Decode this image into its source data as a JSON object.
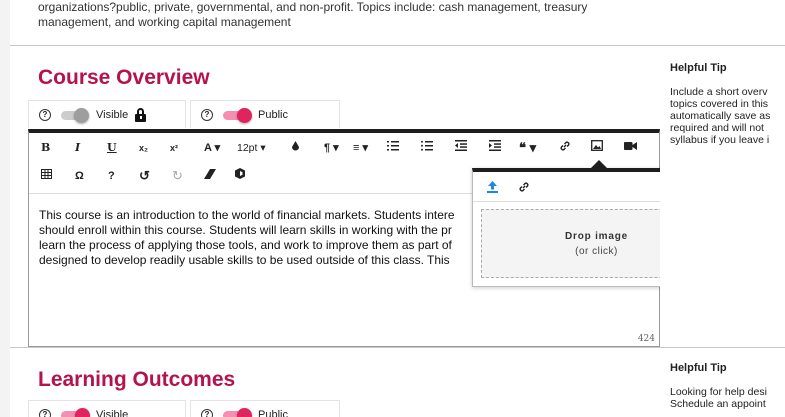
{
  "top_section": {
    "description_line1": "organizations?public, private, governmental, and non-profit. Topics include: cash management, treasury",
    "description_line2": "management, and working capital management"
  },
  "course_overview": {
    "title": "Course Overview",
    "visible_label": "Visible",
    "visible_on": false,
    "public_label": "Public",
    "public_on": true,
    "editor": {
      "toolbar_row1": [
        "B",
        "I",
        "U",
        "x₂",
        "x²",
        "A ▾",
        "12pt ▾",
        "💧",
        "¶ ▾",
        "≡ ▾",
        "☰",
        "☰",
        "⇤",
        "⇥",
        "❝ ▾",
        "link",
        "image",
        "video"
      ],
      "font_size": "12pt",
      "content_lines": [
        "This course is an introduction to the world of financial markets. Students intere",
        "should enroll within this course. Students will learn skills in working with the pr",
        "learn the process of applying those tools, and work to improve them as part of",
        "designed to develop readily usable skills to be used outside of this class. This"
      ],
      "char_count": "424"
    },
    "image_popup": {
      "drop_title": "Drop image",
      "drop_subtitle": "(or click)"
    }
  },
  "helpful_tip_1": {
    "title": "Helpful Tip",
    "lines": [
      "Include a short overv",
      "topics covered in this",
      "automatically save as",
      "required and will not",
      "syllabus if you leave i"
    ]
  },
  "learning_outcomes": {
    "title": "Learning Outcomes",
    "visible_label": "Visible",
    "visible_on": true,
    "public_label": "Public",
    "public_on": true
  },
  "helpful_tip_2": {
    "title": "Helpful Tip",
    "lines": [
      "Looking for help desi",
      "Schedule an appoint"
    ]
  },
  "colors": {
    "accent": "#b5134e",
    "toggle_on": "#e0245e",
    "toggle_off": "#9e9e9e",
    "upload_icon": "#1e88e5"
  }
}
